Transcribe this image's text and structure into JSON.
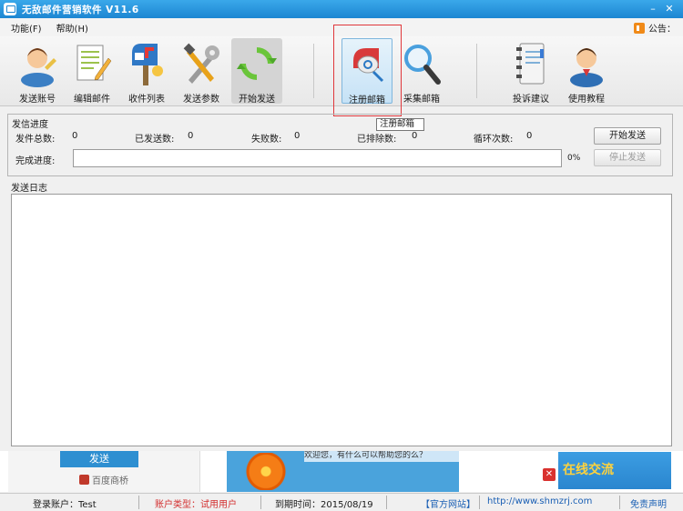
{
  "window": {
    "title": "无敌邮件营销软件  V11.6",
    "minimize": "–",
    "close": "✕"
  },
  "menu": {
    "items": [
      "功能(F)",
      "帮助(H)"
    ],
    "notice_label": "公告："
  },
  "toolbar": {
    "items": [
      {
        "label": "发送账号",
        "icon": "user-icon"
      },
      {
        "label": "编辑邮件",
        "icon": "edit-document-icon"
      },
      {
        "label": "收件列表",
        "icon": "mailbox-icon"
      },
      {
        "label": "发送参数",
        "icon": "tools-icon"
      },
      {
        "label": "开始发送",
        "icon": "refresh-arrows-icon"
      },
      {
        "label": "注册邮箱",
        "icon": "register-mail-icon"
      },
      {
        "label": "采集邮箱",
        "icon": "magnifier-icon"
      },
      {
        "label": "投诉建议",
        "icon": "notebook-icon"
      },
      {
        "label": "使用教程",
        "icon": "tutorial-user-icon"
      }
    ],
    "tooltip": "注册邮箱"
  },
  "progress": {
    "group_title": "发信进度",
    "total_label": "发件总数:",
    "total_value": "0",
    "sent_label": "已发送数:",
    "sent_value": "0",
    "failed_label": "失败数:",
    "failed_value": "0",
    "queued_label": "已排除数:",
    "queued_value": "0",
    "loop_label": "循环次数:",
    "loop_value": "0",
    "done_label": "完成进度:",
    "percent": "0%",
    "start_button": "开始发送",
    "stop_button": "停止发送"
  },
  "log": {
    "title": "发送日志"
  },
  "ads": {
    "send": "发送",
    "baidu": "百度商桥",
    "chat": "欢迎您，有什么可以帮助您的么？",
    "online": "在线交流"
  },
  "status": {
    "account": "登录账户：Test",
    "user_type": "账户类型：试用用户",
    "expiry": "到期时间：2015/08/19",
    "official_site": "【官方网站】",
    "url": "http://www.shmzrj.com",
    "disclaimer": "免责声明"
  }
}
